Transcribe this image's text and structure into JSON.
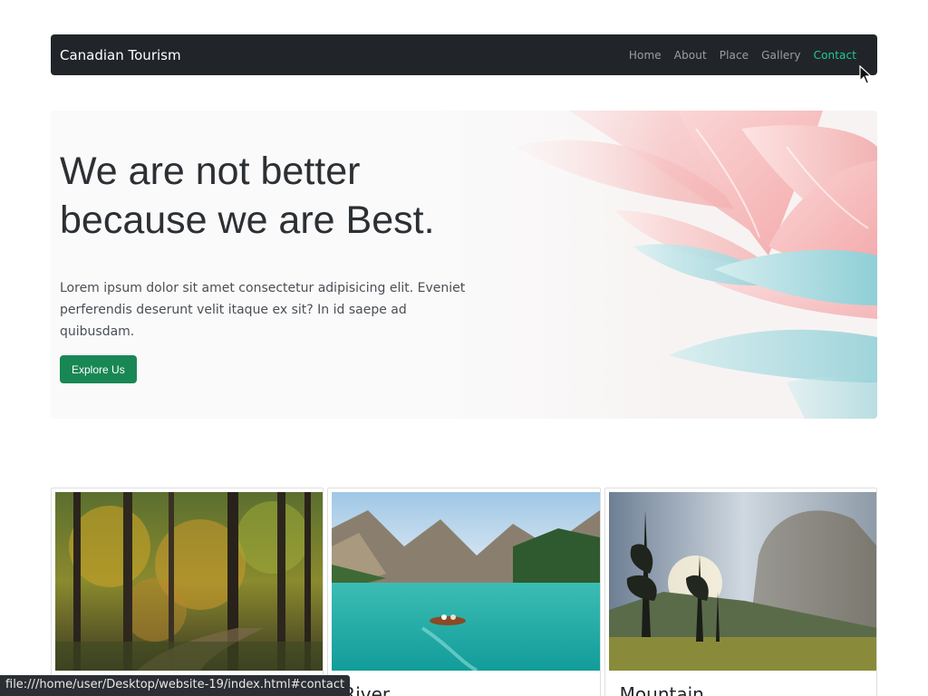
{
  "navbar": {
    "brand": "Canadian Tourism",
    "links": [
      {
        "label": "Home"
      },
      {
        "label": "About"
      },
      {
        "label": "Place"
      },
      {
        "label": "Gallery"
      },
      {
        "label": "Contact"
      }
    ],
    "active_link": "Contact",
    "active_color": "#20c997"
  },
  "hero": {
    "title_line1": "We are not better",
    "title_line2": "because we are Best.",
    "text": "Lorem ipsum dolor sit amet consectetur adipisicing elit. Eveniet perferendis deserunt velit itaque ex sit? In id saepe ad quibusdam.",
    "button_label": "Explore Us",
    "button_color": "#198754"
  },
  "cards": [
    {
      "title": "",
      "image": "forest-image"
    },
    {
      "title": "River",
      "image": "lake-image"
    },
    {
      "title": "Mountain",
      "image": "mountain-image"
    }
  ],
  "statusbar": {
    "url": "file:///home/user/Desktop/website-19/index.html#contact"
  }
}
